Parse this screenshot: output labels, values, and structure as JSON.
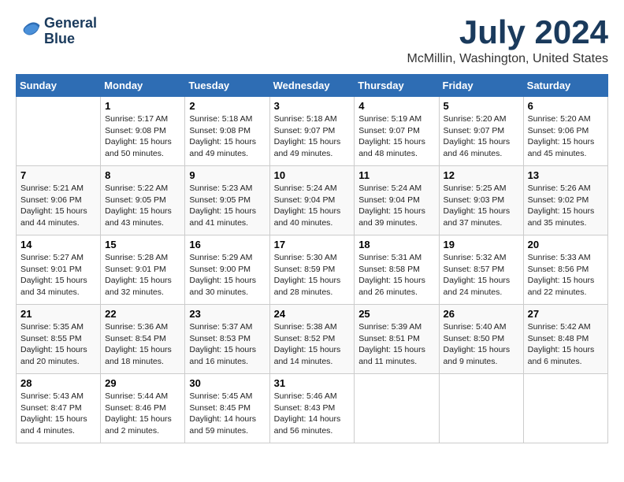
{
  "header": {
    "logo_line1": "General",
    "logo_line2": "Blue",
    "title": "July 2024",
    "subtitle": "McMillin, Washington, United States"
  },
  "calendar": {
    "columns": [
      "Sunday",
      "Monday",
      "Tuesday",
      "Wednesday",
      "Thursday",
      "Friday",
      "Saturday"
    ],
    "weeks": [
      [
        {
          "day": "",
          "info": ""
        },
        {
          "day": "1",
          "info": "Sunrise: 5:17 AM\nSunset: 9:08 PM\nDaylight: 15 hours\nand 50 minutes."
        },
        {
          "day": "2",
          "info": "Sunrise: 5:18 AM\nSunset: 9:08 PM\nDaylight: 15 hours\nand 49 minutes."
        },
        {
          "day": "3",
          "info": "Sunrise: 5:18 AM\nSunset: 9:07 PM\nDaylight: 15 hours\nand 49 minutes."
        },
        {
          "day": "4",
          "info": "Sunrise: 5:19 AM\nSunset: 9:07 PM\nDaylight: 15 hours\nand 48 minutes."
        },
        {
          "day": "5",
          "info": "Sunrise: 5:20 AM\nSunset: 9:07 PM\nDaylight: 15 hours\nand 46 minutes."
        },
        {
          "day": "6",
          "info": "Sunrise: 5:20 AM\nSunset: 9:06 PM\nDaylight: 15 hours\nand 45 minutes."
        }
      ],
      [
        {
          "day": "7",
          "info": "Sunrise: 5:21 AM\nSunset: 9:06 PM\nDaylight: 15 hours\nand 44 minutes."
        },
        {
          "day": "8",
          "info": "Sunrise: 5:22 AM\nSunset: 9:05 PM\nDaylight: 15 hours\nand 43 minutes."
        },
        {
          "day": "9",
          "info": "Sunrise: 5:23 AM\nSunset: 9:05 PM\nDaylight: 15 hours\nand 41 minutes."
        },
        {
          "day": "10",
          "info": "Sunrise: 5:24 AM\nSunset: 9:04 PM\nDaylight: 15 hours\nand 40 minutes."
        },
        {
          "day": "11",
          "info": "Sunrise: 5:24 AM\nSunset: 9:04 PM\nDaylight: 15 hours\nand 39 minutes."
        },
        {
          "day": "12",
          "info": "Sunrise: 5:25 AM\nSunset: 9:03 PM\nDaylight: 15 hours\nand 37 minutes."
        },
        {
          "day": "13",
          "info": "Sunrise: 5:26 AM\nSunset: 9:02 PM\nDaylight: 15 hours\nand 35 minutes."
        }
      ],
      [
        {
          "day": "14",
          "info": "Sunrise: 5:27 AM\nSunset: 9:01 PM\nDaylight: 15 hours\nand 34 minutes."
        },
        {
          "day": "15",
          "info": "Sunrise: 5:28 AM\nSunset: 9:01 PM\nDaylight: 15 hours\nand 32 minutes."
        },
        {
          "day": "16",
          "info": "Sunrise: 5:29 AM\nSunset: 9:00 PM\nDaylight: 15 hours\nand 30 minutes."
        },
        {
          "day": "17",
          "info": "Sunrise: 5:30 AM\nSunset: 8:59 PM\nDaylight: 15 hours\nand 28 minutes."
        },
        {
          "day": "18",
          "info": "Sunrise: 5:31 AM\nSunset: 8:58 PM\nDaylight: 15 hours\nand 26 minutes."
        },
        {
          "day": "19",
          "info": "Sunrise: 5:32 AM\nSunset: 8:57 PM\nDaylight: 15 hours\nand 24 minutes."
        },
        {
          "day": "20",
          "info": "Sunrise: 5:33 AM\nSunset: 8:56 PM\nDaylight: 15 hours\nand 22 minutes."
        }
      ],
      [
        {
          "day": "21",
          "info": "Sunrise: 5:35 AM\nSunset: 8:55 PM\nDaylight: 15 hours\nand 20 minutes."
        },
        {
          "day": "22",
          "info": "Sunrise: 5:36 AM\nSunset: 8:54 PM\nDaylight: 15 hours\nand 18 minutes."
        },
        {
          "day": "23",
          "info": "Sunrise: 5:37 AM\nSunset: 8:53 PM\nDaylight: 15 hours\nand 16 minutes."
        },
        {
          "day": "24",
          "info": "Sunrise: 5:38 AM\nSunset: 8:52 PM\nDaylight: 15 hours\nand 14 minutes."
        },
        {
          "day": "25",
          "info": "Sunrise: 5:39 AM\nSunset: 8:51 PM\nDaylight: 15 hours\nand 11 minutes."
        },
        {
          "day": "26",
          "info": "Sunrise: 5:40 AM\nSunset: 8:50 PM\nDaylight: 15 hours\nand 9 minutes."
        },
        {
          "day": "27",
          "info": "Sunrise: 5:42 AM\nSunset: 8:48 PM\nDaylight: 15 hours\nand 6 minutes."
        }
      ],
      [
        {
          "day": "28",
          "info": "Sunrise: 5:43 AM\nSunset: 8:47 PM\nDaylight: 15 hours\nand 4 minutes."
        },
        {
          "day": "29",
          "info": "Sunrise: 5:44 AM\nSunset: 8:46 PM\nDaylight: 15 hours\nand 2 minutes."
        },
        {
          "day": "30",
          "info": "Sunrise: 5:45 AM\nSunset: 8:45 PM\nDaylight: 14 hours\nand 59 minutes."
        },
        {
          "day": "31",
          "info": "Sunrise: 5:46 AM\nSunset: 8:43 PM\nDaylight: 14 hours\nand 56 minutes."
        },
        {
          "day": "",
          "info": ""
        },
        {
          "day": "",
          "info": ""
        },
        {
          "day": "",
          "info": ""
        }
      ]
    ]
  }
}
